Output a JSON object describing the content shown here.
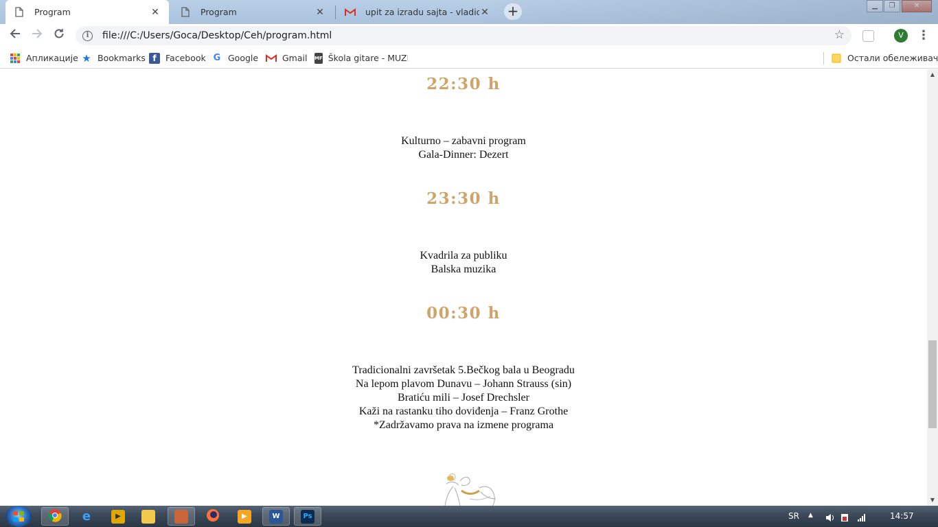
{
  "browser": {
    "tabs": [
      {
        "title": "Program",
        "icon": "document-icon",
        "active": true
      },
      {
        "title": "Program",
        "icon": "document-icon",
        "active": false
      },
      {
        "title": "upit za izradu sajta - vladica.aleks",
        "icon": "gmail-icon",
        "active": false
      }
    ],
    "new_tab_label": "+",
    "window_controls": {
      "minimize": "▁",
      "maximize": "❐",
      "close": "✕"
    },
    "url": "file:///C:/Users/Goca/Desktop/Ceh/program.html",
    "profile_initial": "V"
  },
  "bookmarks": {
    "items": [
      {
        "label": "Апликације",
        "icon": "apps-grid-icon"
      },
      {
        "label": "Bookmarks",
        "icon": "star-icon"
      },
      {
        "label": "Facebook",
        "icon": "facebook-icon"
      },
      {
        "label": "Google",
        "icon": "google-icon"
      },
      {
        "label": "Gmail",
        "icon": "gmail-icon"
      },
      {
        "label": "Škola gitare - MUZIC",
        "icon": "mf-icon"
      }
    ],
    "other_label": "Остали обележивачи"
  },
  "program": {
    "time1": "22:30 h",
    "block1": [
      "Kulturno – zabavni program",
      "Gala-Dinner: Dezert"
    ],
    "time2": "23:30 h",
    "block2": [
      "Kvadrila za publiku",
      "Balska muzika"
    ],
    "time3": "00:30 h",
    "block3": [
      "Tradicionalni završetak 5.Bečkog bala u Beogradu",
      "Na lepom plavom Dunavu – Johann Strauss (sin)",
      "Bratiću mili – Josef Drechsler",
      "Kaži na rastanku tiho doviđenja – Franz Grothe",
      "*Zadržavamo prava na izmene programa"
    ],
    "accent_color": "#cfa468"
  },
  "taskbar": {
    "language": "SR",
    "clock": "14:57"
  }
}
